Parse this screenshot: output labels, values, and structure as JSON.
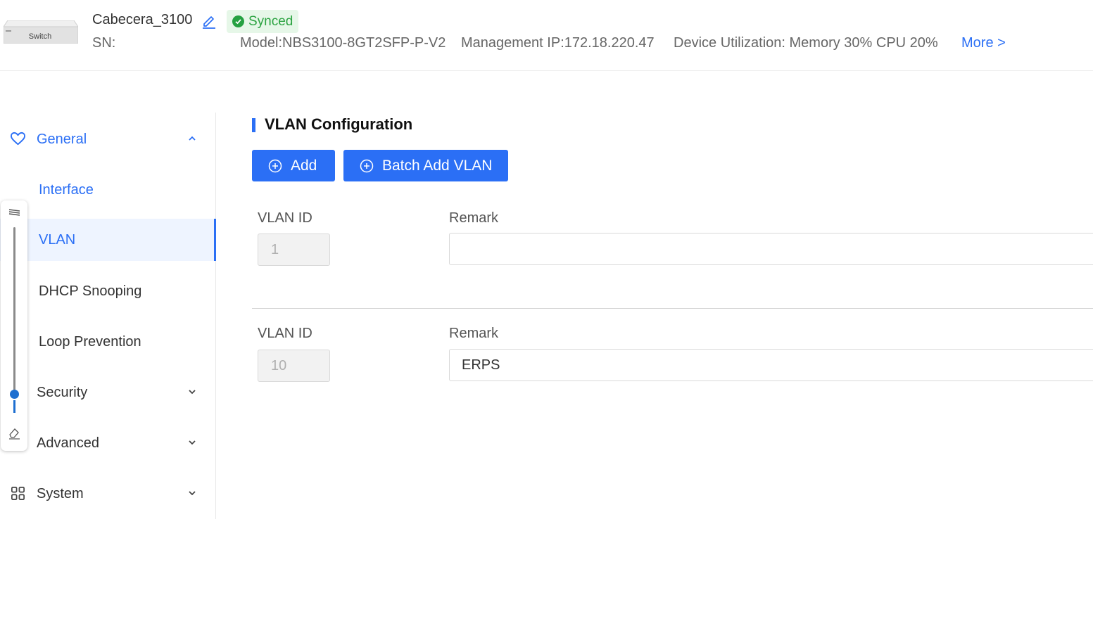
{
  "device": {
    "image_label": "Switch",
    "name": "Cabecera_3100",
    "status": "Synced",
    "sn": "SN:",
    "model": "Model:NBS3100-8GT2SFP-P-V2",
    "management_ip": "Management IP:172.18.220.47",
    "utilization": "Device Utilization: Memory 30% CPU 20%",
    "more": "More >"
  },
  "sidebar": {
    "groups": [
      {
        "label": "General",
        "icon": "heart-icon",
        "expanded": true,
        "items": [
          {
            "label": "Interface"
          },
          {
            "label": "VLAN",
            "active": true
          },
          {
            "label": "DHCP Snooping"
          },
          {
            "label": "Loop Prevention"
          }
        ]
      },
      {
        "label": "Security",
        "icon": "",
        "expanded": false
      },
      {
        "label": "Advanced",
        "icon": "",
        "expanded": false
      },
      {
        "label": "System",
        "icon": "grid-icon",
        "expanded": false
      }
    ]
  },
  "main": {
    "title": "VLAN Configuration",
    "add_button": "Add",
    "batch_add_button": "Batch Add VLAN",
    "vlans": [
      {
        "id_label": "VLAN ID",
        "id": "1",
        "remark_label": "Remark",
        "remark": ""
      },
      {
        "id_label": "VLAN ID",
        "id": "10",
        "remark_label": "Remark",
        "remark": "ERPS"
      }
    ]
  },
  "colors": {
    "accent": "#2b6ff5",
    "synced_text": "#2ba341",
    "synced_bg": "#e6f7e8",
    "active_bg": "#eef4ff"
  }
}
